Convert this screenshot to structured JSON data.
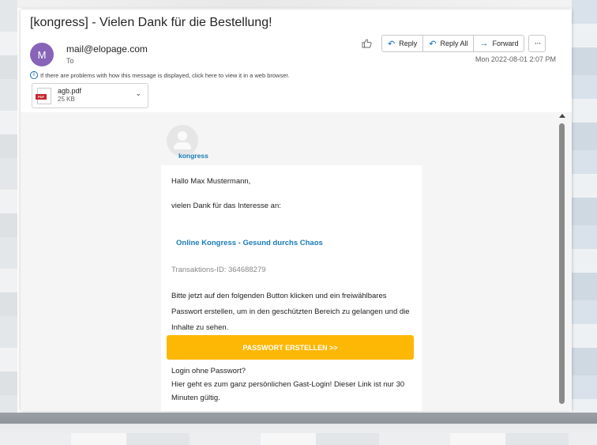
{
  "header": {
    "subject": "[kongress] - Vielen Dank für die Bestellung!",
    "avatar_initial": "M",
    "sender": "mail@elopage.com",
    "to_label": "To",
    "date": "Mon 2022-08-01 2:07 PM",
    "info_text": "If there are problems with how this message is displayed, click here to view it in a web browser."
  },
  "actions": {
    "reply": "Reply",
    "reply_all": "Reply All",
    "forward": "Forward",
    "more": "···"
  },
  "attachment": {
    "name": "agb.pdf",
    "size": "25 KB",
    "badge": "PDF"
  },
  "email": {
    "brand": "kongress",
    "greeting": "Hallo Max Mustermann,",
    "intro": "vielen Dank für das Interesse an:",
    "course": "Online Kongress - Gesund durchs Chaos",
    "transaction": "Transaktions-ID: 364688279",
    "instruction": "Bitte jetzt auf den folgenden Button klicken und ein freiwählbares Passwort erstellen, um in den geschützten Bereich zu gelangen und die Inhalte zu sehen.",
    "cta": "PASSWORT ERSTELLEN >>",
    "login_heading": "Login ohne Passwort?",
    "login_text": "Hier geht es zum ganz persönlichen Gast-Login! Dieser Link ist nur 30 Minuten gültig."
  },
  "colors": {
    "avatar": "#8764b8",
    "accent": "#0f6cbd",
    "brand_link": "#1a7bb8",
    "cta": "#fdb705"
  }
}
